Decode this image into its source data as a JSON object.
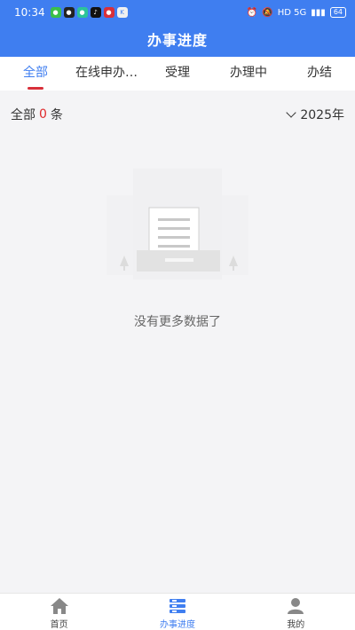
{
  "status": {
    "time": "10:34",
    "battery": "64",
    "network": "HD 5G"
  },
  "header": {
    "title": "办事进度"
  },
  "tabs": [
    {
      "label": "全部",
      "active": true
    },
    {
      "label": "在线申办…",
      "active": false
    },
    {
      "label": "受理",
      "active": false
    },
    {
      "label": "办理中",
      "active": false
    },
    {
      "label": "办结",
      "active": false
    }
  ],
  "summary": {
    "prefix": "全部",
    "count": "0",
    "suffix": "条",
    "year": "2025年"
  },
  "empty": {
    "message": "没有更多数据了"
  },
  "bottom_nav": [
    {
      "label": "首页",
      "icon": "home-icon",
      "active": false
    },
    {
      "label": "办事进度",
      "icon": "progress-list-icon",
      "active": true
    },
    {
      "label": "我的",
      "icon": "user-icon",
      "active": false
    }
  ],
  "colors": {
    "primary": "#3f7ef0",
    "accent_red": "#e0292b",
    "background": "#f4f4f6"
  }
}
